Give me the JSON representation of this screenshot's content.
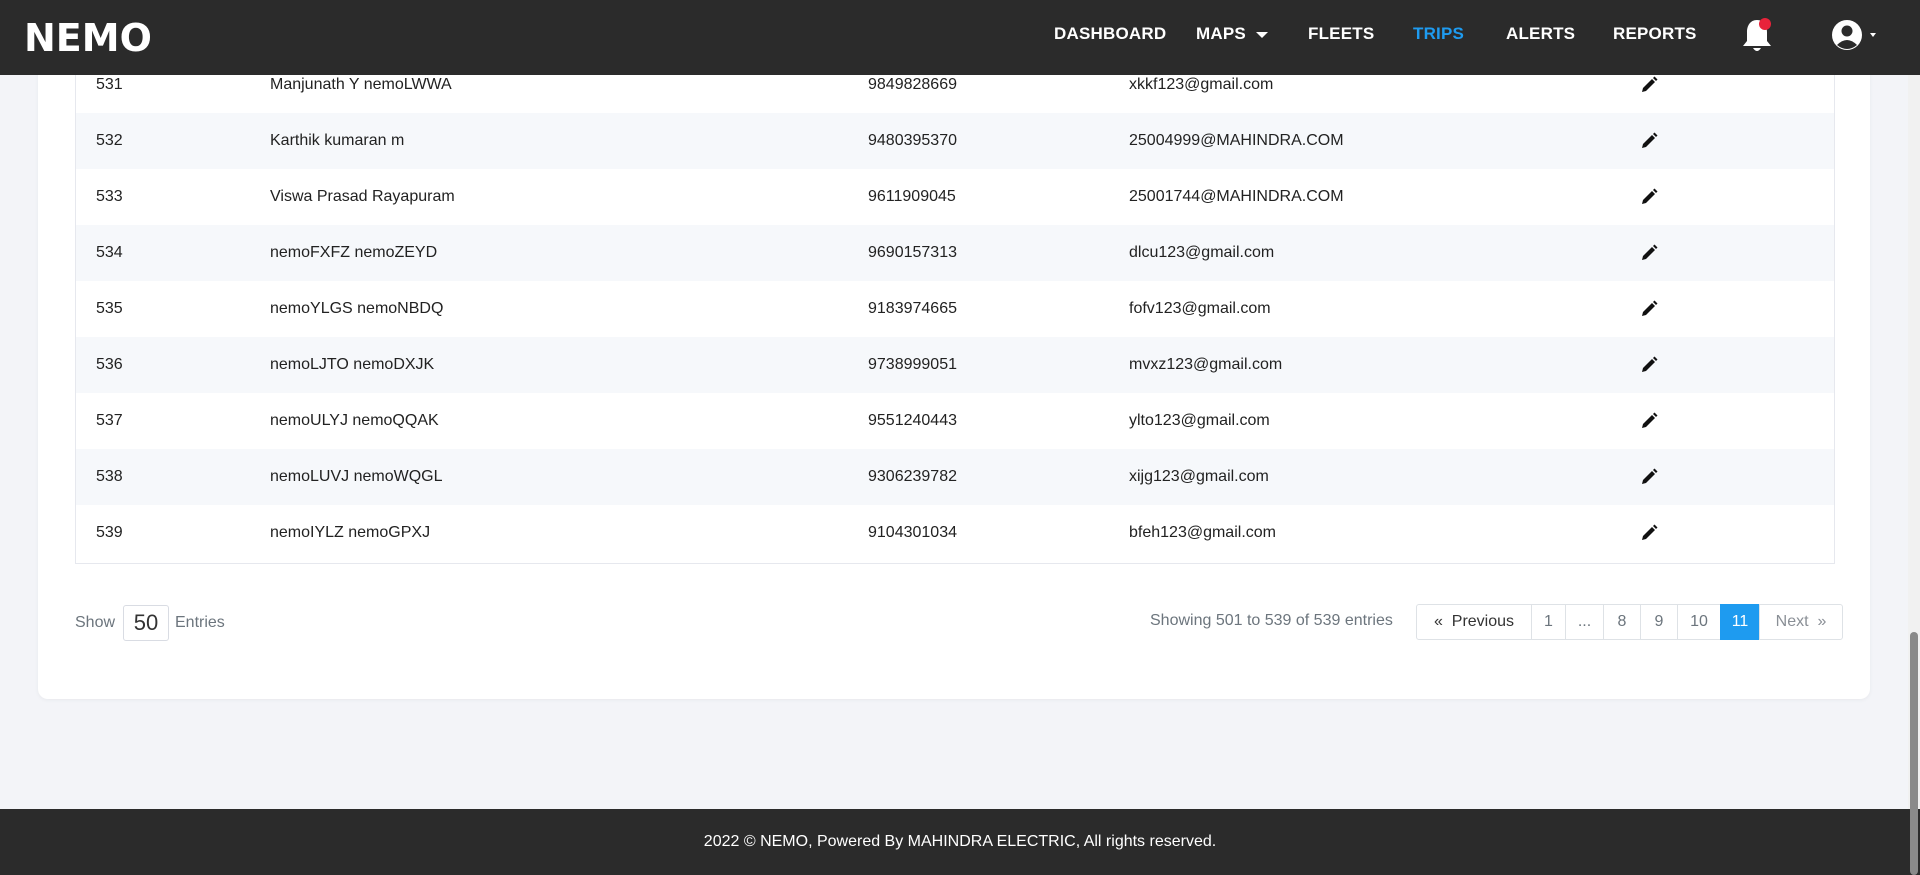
{
  "app": {
    "logo": "NEMO"
  },
  "nav": {
    "items": [
      {
        "label": "DASHBOARD"
      },
      {
        "label": "MAPS"
      },
      {
        "label": "FLEETS"
      },
      {
        "label": "TRIPS"
      },
      {
        "label": "ALERTS"
      },
      {
        "label": "REPORTS"
      }
    ],
    "active": "TRIPS",
    "accent_color": "#1e9bf0",
    "notification_dot_color": "#e8233a"
  },
  "table": {
    "rows": [
      {
        "id": "531",
        "name": "Manjunath Y nemoLWWA",
        "phone": "9849828669",
        "email": "xkkf123@gmail.com"
      },
      {
        "id": "532",
        "name": "Karthik kumaran m",
        "phone": "9480395370",
        "email": "25004999@MAHINDRA.COM"
      },
      {
        "id": "533",
        "name": "Viswa Prasad Rayapuram",
        "phone": "9611909045",
        "email": "25001744@MAHINDRA.COM"
      },
      {
        "id": "534",
        "name": "nemoFXFZ nemoZEYD",
        "phone": "9690157313",
        "email": "dlcu123@gmail.com"
      },
      {
        "id": "535",
        "name": "nemoYLGS nemoNBDQ",
        "phone": "9183974665",
        "email": "fofv123@gmail.com"
      },
      {
        "id": "536",
        "name": "nemoLJTO nemoDXJK",
        "phone": "9738999051",
        "email": "mvxz123@gmail.com"
      },
      {
        "id": "537",
        "name": "nemoULYJ nemoQQAK",
        "phone": "9551240443",
        "email": "ylto123@gmail.com"
      },
      {
        "id": "538",
        "name": "nemoLUVJ nemoWQGL",
        "phone": "9306239782",
        "email": "xijg123@gmail.com"
      },
      {
        "id": "539",
        "name": "nemoIYLZ nemoGPXJ",
        "phone": "9104301034",
        "email": "bfeh123@gmail.com"
      }
    ]
  },
  "length": {
    "show_label": "Show",
    "value": "50",
    "entries_label": "Entries"
  },
  "info": "Showing 501 to 539 of 539 entries",
  "pagination": {
    "prev": "Previous",
    "prev_glyph": "«",
    "pages": [
      "1",
      "...",
      "8",
      "9",
      "10",
      "11"
    ],
    "active": "11",
    "next": "Next",
    "next_glyph": "»"
  },
  "footer": {
    "text": "2022 © NEMO, Powered By MAHINDRA ELECTRIC, All rights reserved."
  }
}
